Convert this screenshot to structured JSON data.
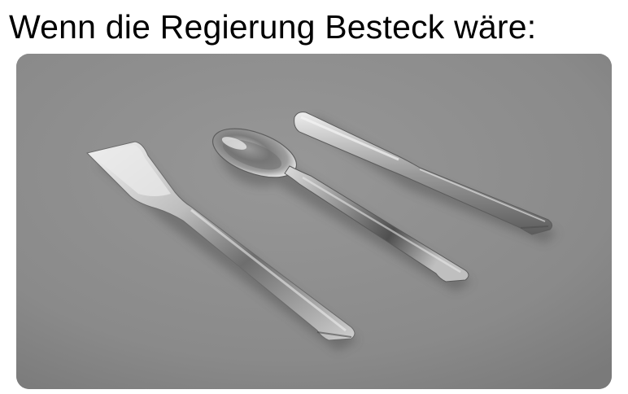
{
  "caption": {
    "text": "Wenn die Regierung Besteck wäre:"
  },
  "photo": {
    "items": [
      {
        "name": "spatula-fork",
        "icon": "flat-spatula-utensil-icon"
      },
      {
        "name": "spoon",
        "icon": "spoon-icon"
      },
      {
        "name": "knife",
        "icon": "blunt-knife-icon"
      }
    ],
    "colors": {
      "background": "#8c8c8c",
      "metal_light": "#e6e6e6",
      "metal_mid": "#b4b4b4",
      "metal_dark": "#5a5a5a"
    }
  }
}
